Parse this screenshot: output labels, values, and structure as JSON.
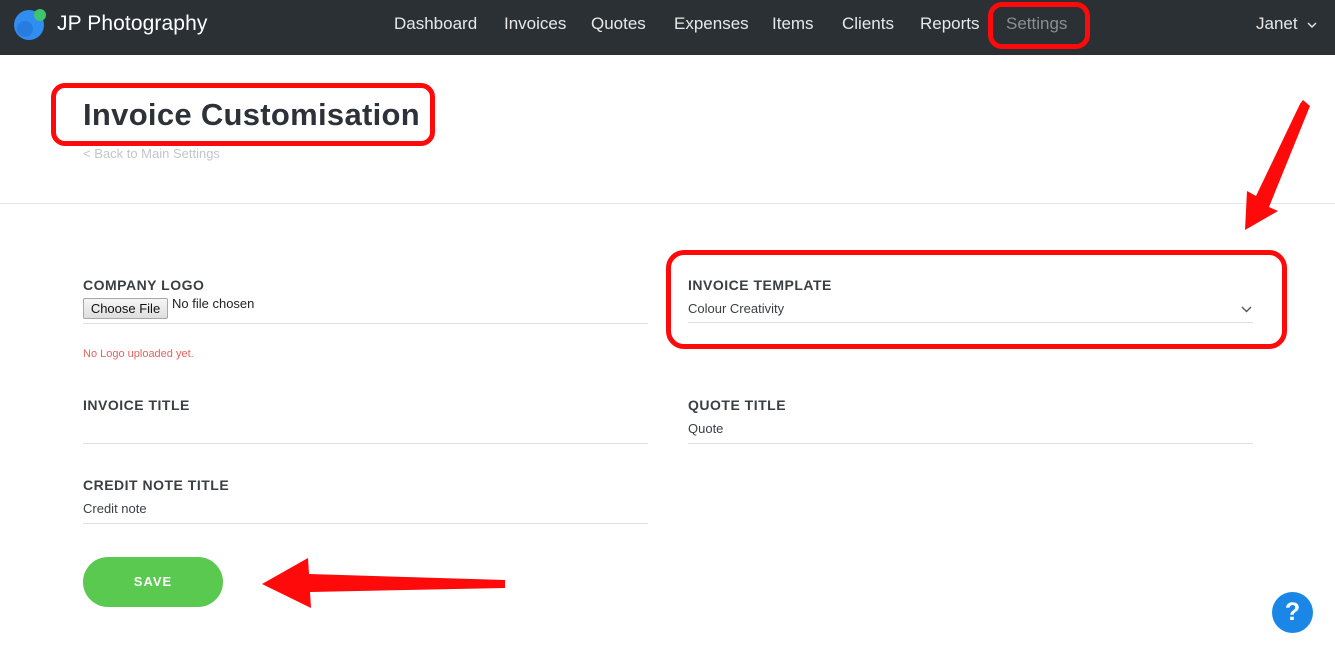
{
  "header": {
    "brand": "JP Photography",
    "nav": [
      "Dashboard",
      "Invoices",
      "Quotes",
      "Expenses",
      "Items",
      "Clients",
      "Reports",
      "Settings"
    ],
    "active_nav": "Settings",
    "user": "Janet"
  },
  "page": {
    "title": "Invoice Customisation",
    "back_link": "< Back to Main Settings"
  },
  "form": {
    "company_logo": {
      "label": "COMPANY LOGO",
      "button": "Choose File",
      "status": "No file chosen",
      "note": "No Logo uploaded yet."
    },
    "invoice_template": {
      "label": "INVOICE TEMPLATE",
      "value": "Colour Creativity"
    },
    "invoice_title": {
      "label": "INVOICE TITLE",
      "value": ""
    },
    "quote_title": {
      "label": "QUOTE TITLE",
      "value": "Quote"
    },
    "credit_note_title": {
      "label": "CREDIT NOTE TITLE",
      "value": "Credit note"
    },
    "save": "SAVE"
  },
  "help": "?",
  "colors": {
    "header_bg": "#2b3035",
    "save_green": "#5ac94f",
    "help_blue": "#1a87e6",
    "highlight_red": "#ff0a0a",
    "note_red": "#e0645f"
  },
  "icons": [
    "logo-icon",
    "chevron-down-icon",
    "help-icon",
    "arrow-annotation"
  ]
}
